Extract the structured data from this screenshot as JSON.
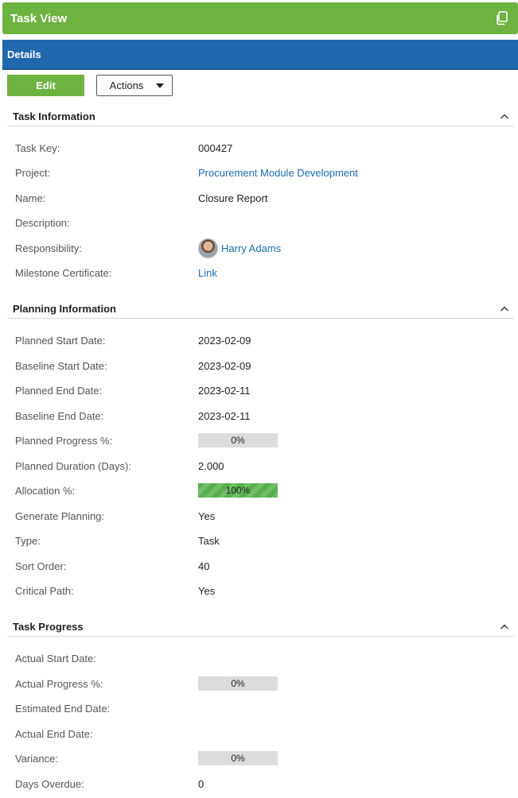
{
  "header": {
    "title": "Task View",
    "icon": "copy-icon"
  },
  "details": {
    "title": "Details"
  },
  "toolbar": {
    "edit_label": "Edit",
    "actions_label": "Actions"
  },
  "sections": {
    "task_info": {
      "title": "Task Information",
      "task_key": {
        "label": "Task Key:",
        "value": "000427"
      },
      "project": {
        "label": "Project:",
        "value": "Procurement Module Development"
      },
      "name": {
        "label": "Name:",
        "value": "Closure Report"
      },
      "description": {
        "label": "Description:",
        "value": ""
      },
      "responsibility": {
        "label": "Responsibility:",
        "value": "Harry Adams"
      },
      "milestone": {
        "label": "Milestone Certificate:",
        "value": "Link"
      }
    },
    "planning": {
      "title": "Planning Information",
      "planned_start": {
        "label": "Planned Start Date:",
        "value": "2023-02-09"
      },
      "baseline_start": {
        "label": "Baseline Start Date:",
        "value": "2023-02-09"
      },
      "planned_end": {
        "label": "Planned End Date:",
        "value": "2023-02-11"
      },
      "baseline_end": {
        "label": "Baseline End Date:",
        "value": "2023-02-11"
      },
      "planned_progress": {
        "label": "Planned Progress %:",
        "value": "0%",
        "fraction": 0
      },
      "planned_duration": {
        "label": "Planned Duration (Days):",
        "value": "2.000"
      },
      "allocation": {
        "label": "Allocation %:",
        "value": "100%",
        "fraction": 1.0
      },
      "generate_planning": {
        "label": "Generate Planning:",
        "value": "Yes"
      },
      "type": {
        "label": "Type:",
        "value": "Task"
      },
      "sort_order": {
        "label": "Sort Order:",
        "value": "40"
      },
      "critical_path": {
        "label": "Critical Path:",
        "value": "Yes"
      }
    },
    "progress": {
      "title": "Task Progress",
      "actual_start": {
        "label": "Actual Start Date:",
        "value": ""
      },
      "actual_progress": {
        "label": "Actual Progress %:",
        "value": "0%",
        "fraction": 0
      },
      "estimated_end": {
        "label": "Estimated End Date:",
        "value": ""
      },
      "actual_end": {
        "label": "Actual End Date:",
        "value": ""
      },
      "variance": {
        "label": "Variance:",
        "value": "0%",
        "fraction": 0
      },
      "days_overdue": {
        "label": "Days Overdue:",
        "value": "0"
      }
    }
  },
  "colors": {
    "header_green": "#6cb33f",
    "details_blue": "#2068ad",
    "link_blue": "#1e6bb0",
    "progress_green": "#58ad4f"
  }
}
